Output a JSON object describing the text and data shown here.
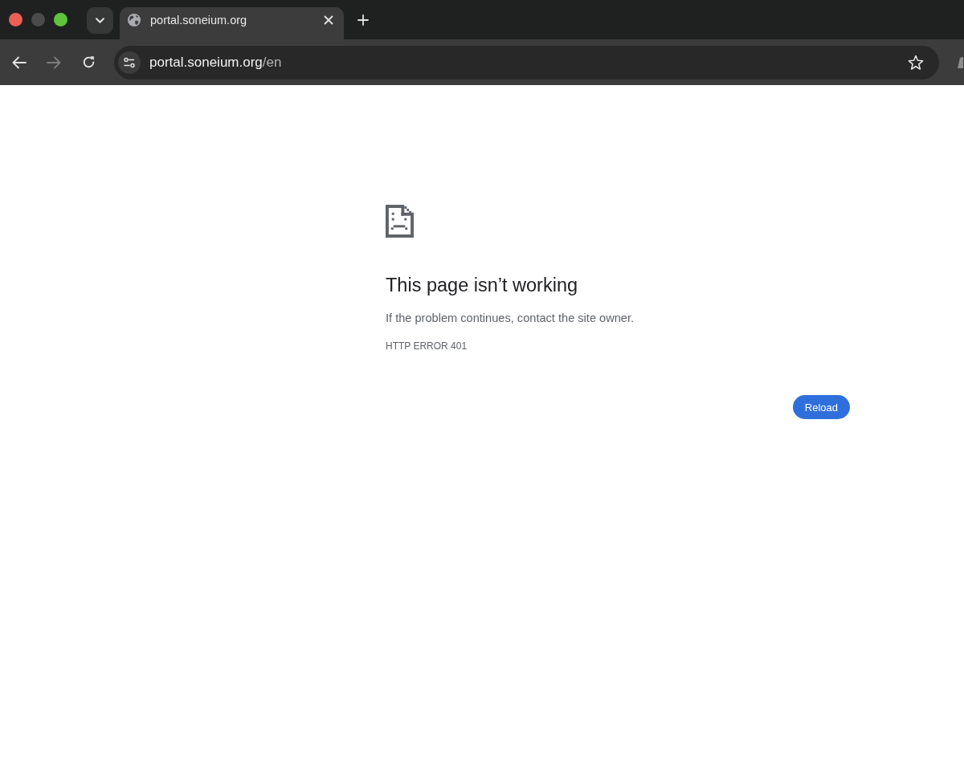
{
  "window": {
    "controls": [
      {
        "color": "#ec5f57"
      },
      {
        "color": "#4b4b4b"
      },
      {
        "color": "#5ec43a"
      }
    ]
  },
  "tabs": [
    {
      "title": "portal.soneium.org",
      "selected": true
    }
  ],
  "toolbar": {
    "back": {
      "disabled": false
    },
    "forward": {
      "disabled": true
    }
  },
  "address_bar": {
    "host": "portal.soneium.org",
    "path": "/en",
    "bookmarked": false
  },
  "error": {
    "heading": "This page isn’t working",
    "message": "If the problem continues, contact the site owner.",
    "code": "HTTP ERROR 401",
    "button": "Reload"
  }
}
